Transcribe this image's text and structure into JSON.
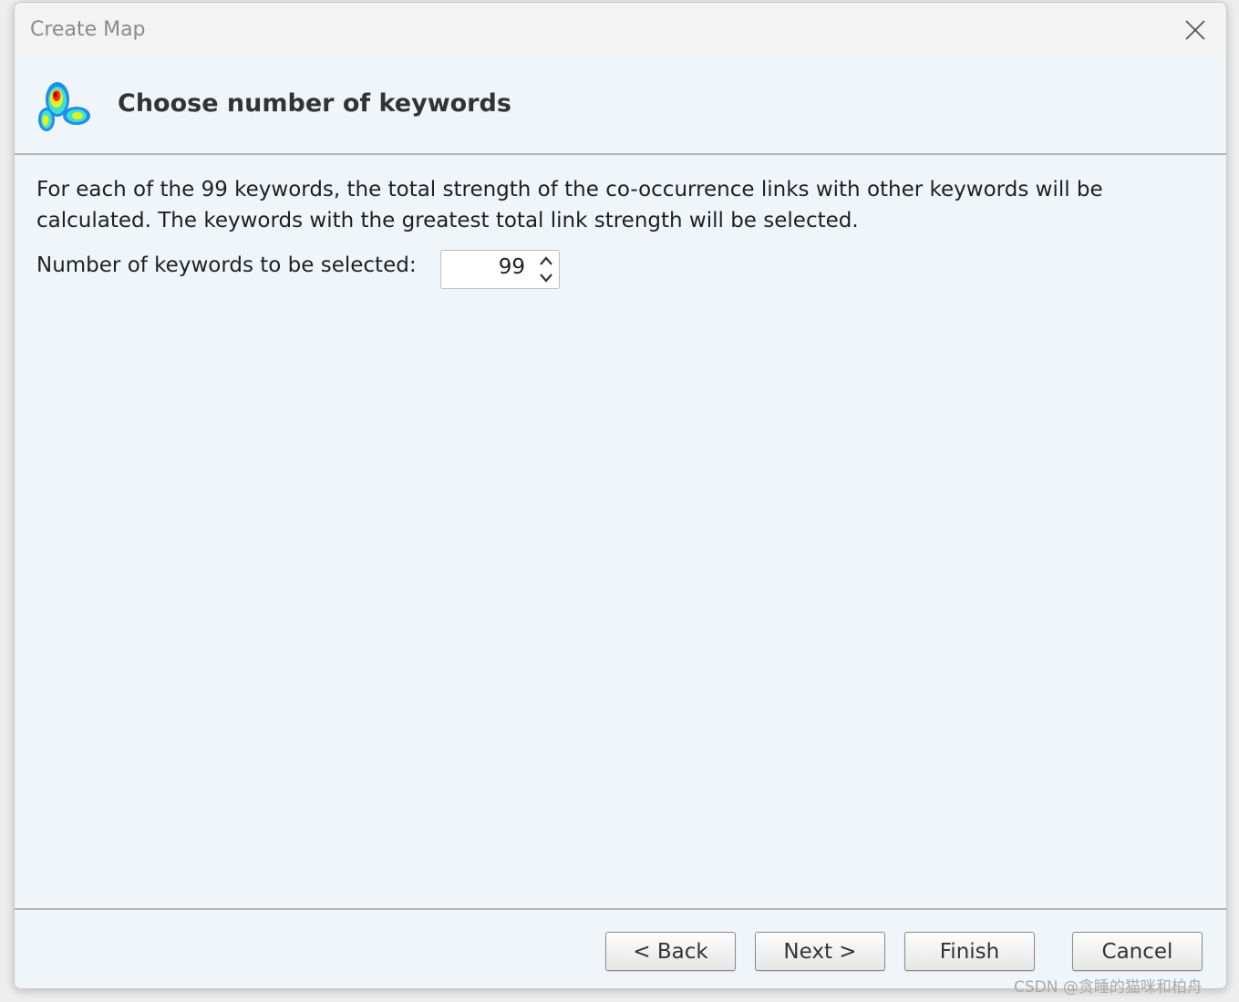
{
  "window": {
    "title": "Create Map"
  },
  "header": {
    "title": "Choose number of keywords",
    "icon": "density-map-icon"
  },
  "content": {
    "description": "For each of the 99 keywords, the total strength of the co-occurrence links with other keywords will be calculated. The keywords with the greatest total link strength will be selected.",
    "field_label": "Number of keywords to be selected:",
    "field_value": "99"
  },
  "buttons": {
    "back": "< Back",
    "next": "Next >",
    "finish": "Finish",
    "cancel": "Cancel"
  },
  "watermark": "CSDN @贪睡的猫咪和柏舟",
  "colors": {
    "window_bg": "#f0f5fa",
    "titlebar_bg": "#f3f3f3",
    "divider": "#b4b4b4"
  }
}
